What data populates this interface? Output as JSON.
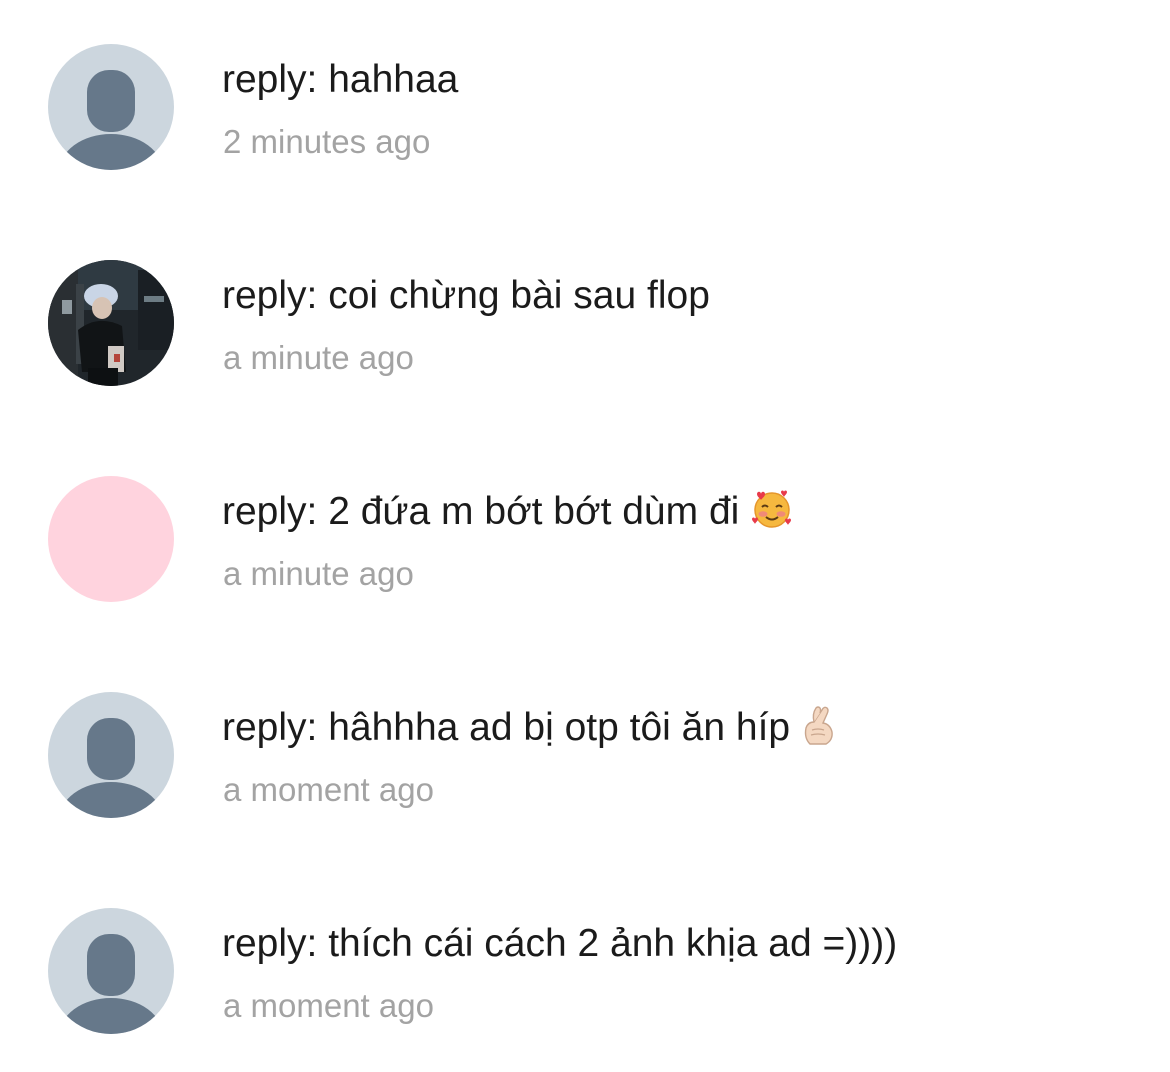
{
  "replies": [
    {
      "avatar": "default-person-icon",
      "text": "reply: hahhaa",
      "time": "2 minutes ago"
    },
    {
      "avatar": "user-photo",
      "text": "reply: coi chừng bài sau flop",
      "time": "a minute ago"
    },
    {
      "avatar": "pink-circle",
      "text": "reply: 2 đứa m bớt bớt dùm đi",
      "emoji": "smiling-face-with-hearts-emoji",
      "time": "a minute ago"
    },
    {
      "avatar": "default-person-icon",
      "text": "reply: hâhhha ad bị otp tôi ăn híp",
      "emoji": "hand-with-index-finger-and-thumb-crossed-emoji",
      "time": "a moment ago"
    },
    {
      "avatar": "default-person-icon",
      "text": "reply: thích cái cách 2 ảnh khịa ad =))))",
      "time": "a moment ago"
    }
  ],
  "colors": {
    "text": "#1b1b1b",
    "timestamp": "#a3a3a3",
    "default_avatar_bg": "#ccd6de",
    "default_avatar_fg": "#66788a",
    "pink_avatar": "#ffd3de"
  }
}
